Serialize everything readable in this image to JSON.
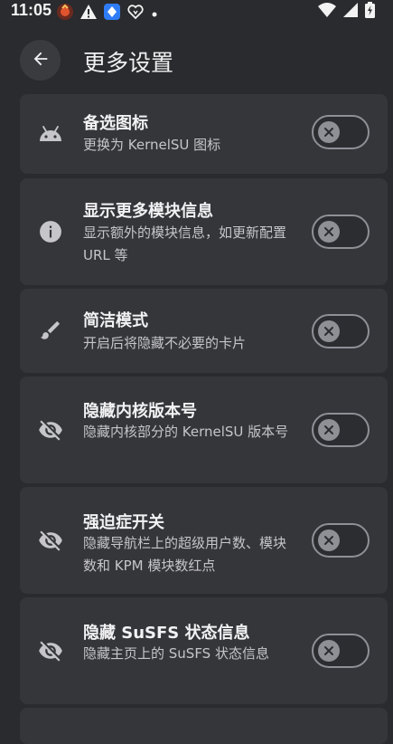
{
  "status_bar": {
    "time": "11:05",
    "left_icons": [
      "app-notification-icon",
      "warning-icon",
      "shield-app-icon",
      "heart-app-icon",
      "dot-icon"
    ],
    "right_icons": [
      "wifi-icon",
      "signal-icon",
      "battery-icon"
    ]
  },
  "header": {
    "title": "更多设置",
    "back_icon": "arrow-back-icon"
  },
  "settings": [
    {
      "icon": "android-icon",
      "title": "备选图标",
      "description": "更换为 KernelSU 图标",
      "enabled": false
    },
    {
      "icon": "info-icon",
      "title": "显示更多模块信息",
      "description": "显示额外的模块信息，如更新配置 URL 等",
      "enabled": false
    },
    {
      "icon": "brush-icon",
      "title": "简洁模式",
      "description": "开启后将隐藏不必要的卡片",
      "enabled": false
    },
    {
      "icon": "visibility-off-icon",
      "title": "隐藏内核版本号",
      "description": "隐藏内核部分的 KernelSU 版本号",
      "enabled": false
    },
    {
      "icon": "visibility-off-icon",
      "title": "强迫症开关",
      "description": "隐藏导航栏上的超级用户数、模块数和 KPM 模块数红点",
      "enabled": false
    },
    {
      "icon": "visibility-off-icon",
      "title": "隐藏 SuSFS 状态信息",
      "description": "隐藏主页上的 SuSFS 状态信息",
      "enabled": false
    }
  ],
  "colors": {
    "background": "#2a2b2e",
    "card": "#35363a",
    "toggle_off": "#8f9096"
  }
}
